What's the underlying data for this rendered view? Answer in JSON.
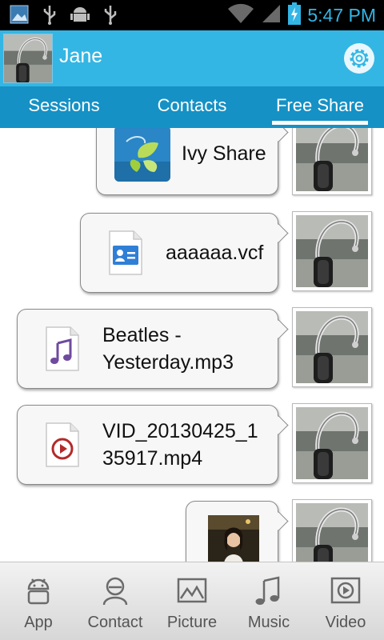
{
  "status_bar": {
    "time": "5:47 PM",
    "icons": [
      "gallery-notification-icon",
      "usb-icon",
      "android-debug-icon",
      "usb-icon",
      "wifi-icon",
      "signal-icon",
      "battery-charging-icon"
    ]
  },
  "header": {
    "username": "Jane",
    "settings_icon": "gear-icon"
  },
  "tabs": [
    {
      "label": "Sessions",
      "active": false
    },
    {
      "label": "Contacts",
      "active": false
    },
    {
      "label": "Free Share",
      "active": true
    }
  ],
  "messages": [
    {
      "type": "app",
      "text": "Ivy Share",
      "icon": "ivy-share-app-icon"
    },
    {
      "type": "file",
      "text": "aaaaaa.vcf",
      "icon": "contact-card-file-icon"
    },
    {
      "type": "file",
      "text": "Beatles - Yesterday.mp3",
      "line1": "Beatles -",
      "line2": "Yesterday.mp3",
      "icon": "music-file-icon"
    },
    {
      "type": "file",
      "text": "VID_20130425_135917.mp4",
      "line1": "VID_20130425_1",
      "line2": "35917.mp4",
      "icon": "video-file-icon"
    },
    {
      "type": "picture",
      "text": "",
      "icon": "photo-thumbnail"
    }
  ],
  "bottom_nav": [
    {
      "label": "App",
      "icon": "android-icon"
    },
    {
      "label": "Contact",
      "icon": "contact-icon"
    },
    {
      "label": "Picture",
      "icon": "picture-icon"
    },
    {
      "label": "Music",
      "icon": "music-note-icon"
    },
    {
      "label": "Video",
      "icon": "video-play-icon"
    }
  ],
  "colors": {
    "header": "#34b6e4",
    "tabs": "#1591c5",
    "time": "#33b5e5",
    "bubble": "#f7f7f7"
  }
}
